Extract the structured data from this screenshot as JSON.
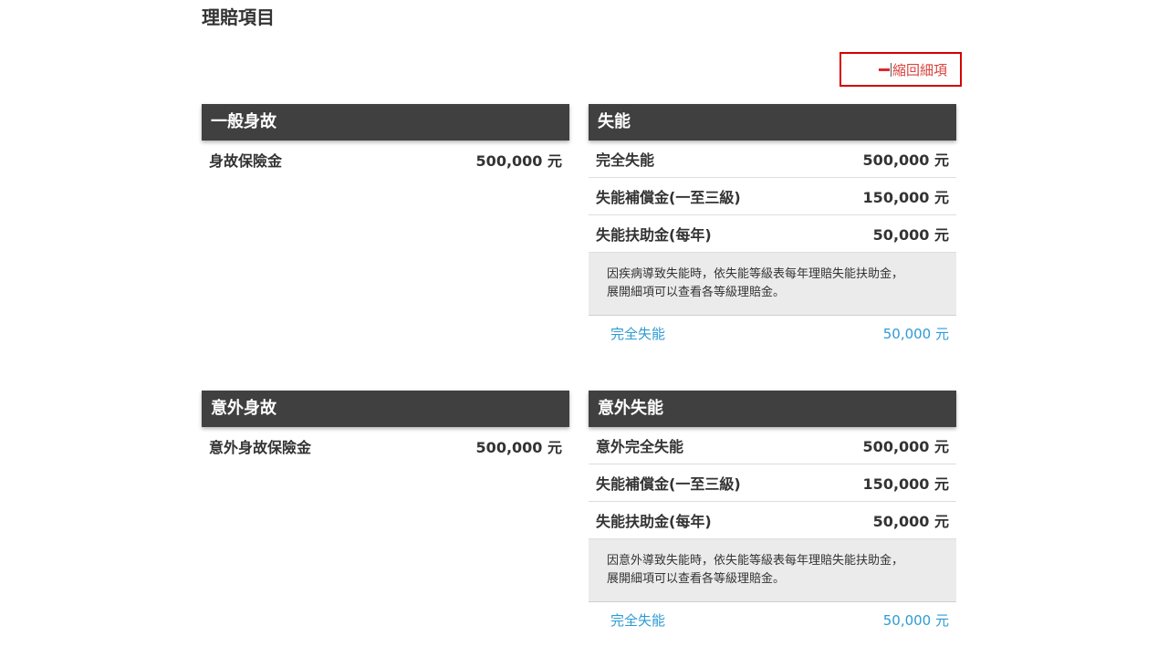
{
  "page": {
    "title": "理賠項目"
  },
  "collapse_button": {
    "label": "縮回細項",
    "icon": "minus-icon"
  },
  "colors": {
    "header_background": "#404040",
    "header_text": "#ffffff",
    "highlight_border": "#d40000",
    "collapse_text": "#d9433d",
    "link_blue": "#2e9bd3",
    "note_background": "#ebebeb"
  },
  "sections": [
    {
      "title": "一般身故",
      "items": [
        {
          "label": "身故保險金",
          "value": "500,000 元"
        }
      ]
    },
    {
      "title": "失能",
      "items": [
        {
          "label": "完全失能",
          "value": "500,000 元"
        },
        {
          "label": "失能補償金(一至三級)",
          "value": "150,000 元"
        },
        {
          "label": "失能扶助金(每年)",
          "value": "50,000 元"
        }
      ],
      "note": {
        "lines": [
          "因疾病導致失能時，依失能等級表每年理賠失能扶助金，",
          "展開細項可以查看各等級理賠金。"
        ]
      },
      "sub_items": [
        {
          "label": "完全失能",
          "value": "50,000 元"
        }
      ]
    },
    {
      "title": "意外身故",
      "items": [
        {
          "label": "意外身故保險金",
          "value": "500,000 元"
        }
      ]
    },
    {
      "title": "意外失能",
      "items": [
        {
          "label": "意外完全失能",
          "value": "500,000 元"
        },
        {
          "label": "失能補償金(一至三級)",
          "value": "150,000 元"
        },
        {
          "label": "失能扶助金(每年)",
          "value": "50,000 元"
        }
      ],
      "note": {
        "lines": [
          "因意外導致失能時，依失能等級表每年理賠失能扶助金，",
          "展開細項可以查看各等級理賠金。"
        ]
      },
      "sub_items": [
        {
          "label": "完全失能",
          "value": "50,000 元"
        }
      ]
    }
  ]
}
